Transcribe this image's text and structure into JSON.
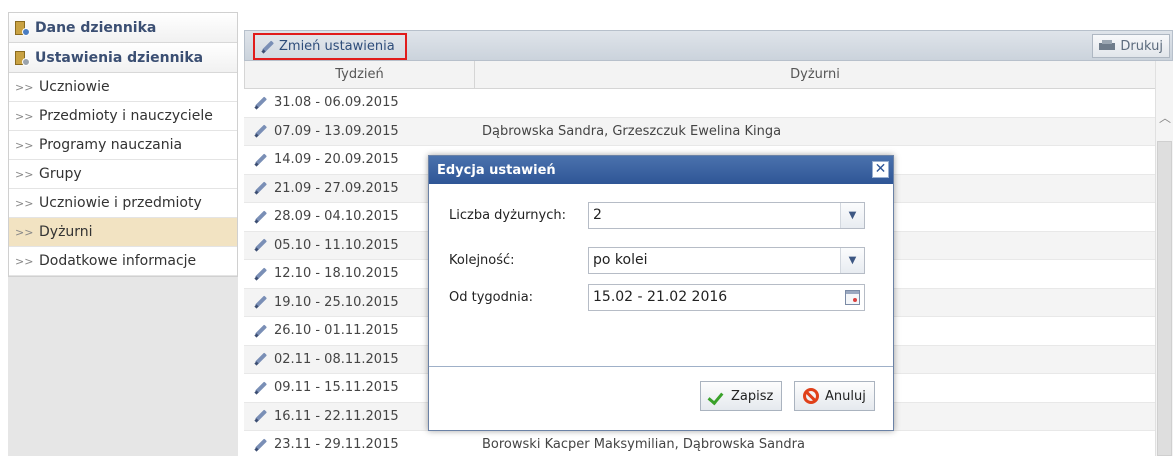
{
  "sidebar": {
    "headers": [
      {
        "label": "Dane dziennika"
      },
      {
        "label": "Ustawienia dziennika"
      }
    ],
    "items": [
      {
        "label": "Uczniowie"
      },
      {
        "label": "Przedmioty i nauczyciele"
      },
      {
        "label": "Programy nauczania"
      },
      {
        "label": "Grupy"
      },
      {
        "label": "Uczniowie i przedmioty"
      },
      {
        "label": "Dyżurni"
      },
      {
        "label": "Dodatkowe informacje"
      }
    ],
    "active_item": "Dyżurni"
  },
  "toolbar": {
    "edit_label": "Zmień ustawienia",
    "print_label": "Drukuj"
  },
  "grid": {
    "columns": [
      "Tydzień",
      "Dyżurni"
    ],
    "rows": [
      {
        "week": "31.08 - 06.09.2015",
        "duty": ""
      },
      {
        "week": "07.09 - 13.09.2015",
        "duty": "Dąbrowska Sandra, Grzeszczuk Ewelina Kinga"
      },
      {
        "week": "14.09 - 20.09.2015",
        "duty": ""
      },
      {
        "week": "21.09 - 27.09.2015",
        "duty": ""
      },
      {
        "week": "28.09 - 04.10.2015",
        "duty": ""
      },
      {
        "week": "05.10 - 11.10.2015",
        "duty": ""
      },
      {
        "week": "12.10 - 18.10.2015",
        "duty": ""
      },
      {
        "week": "19.10 - 25.10.2015",
        "duty": ""
      },
      {
        "week": "26.10 - 01.11.2015",
        "duty": ""
      },
      {
        "week": "02.11 - 08.11.2015",
        "duty": ""
      },
      {
        "week": "09.11 - 15.11.2015",
        "duty": ""
      },
      {
        "week": "16.11 - 22.11.2015",
        "duty": ""
      },
      {
        "week": "23.11 - 29.11.2015",
        "duty": "Borowski Kacper Maksymilian, Dąbrowska Sandra"
      }
    ]
  },
  "dialog": {
    "title": "Edycja ustawień",
    "close_glyph": "✕",
    "fields": {
      "count_label": "Liczba dyżurnych:",
      "count_value": "2",
      "order_label": "Kolejność:",
      "order_value": "po kolei",
      "from_label": "Od tygodnia:",
      "from_value": "15.02 - 21.02 2016"
    },
    "save_label": "Zapisz",
    "cancel_label": "Anuluj"
  },
  "icons": {
    "dropdown": "chevron-down-icon",
    "calendar": "calendar-icon",
    "edit": "pencil-icon",
    "print": "printer-icon"
  },
  "colors": {
    "accent": "#2f5696",
    "highlight_border": "#e11c1c",
    "active_item_bg": "#f2e3c2"
  }
}
